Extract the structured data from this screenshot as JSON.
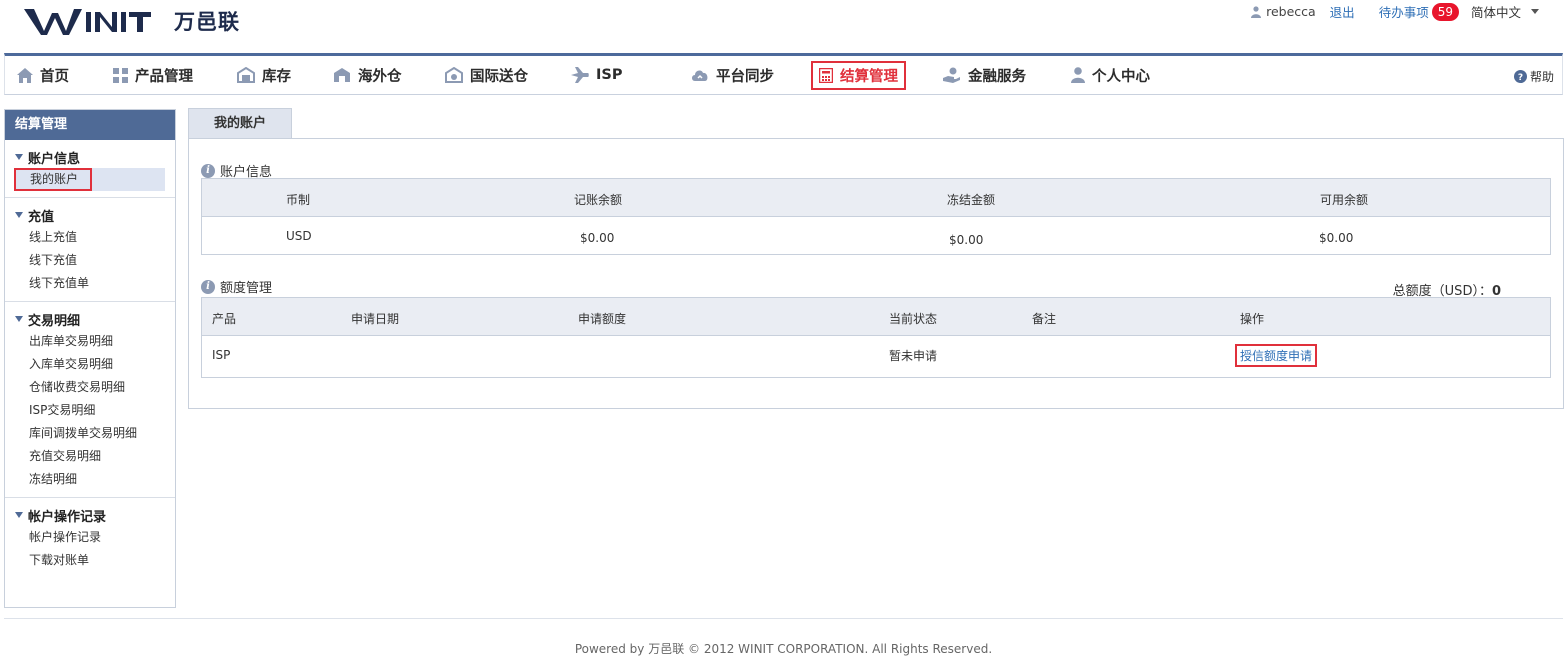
{
  "header": {
    "logo_text": "万邑联",
    "logo_mark": "WINIT",
    "username": "rebecca",
    "logout": "退出",
    "todo_label": "待办事项",
    "todo_count": "59",
    "language": "简体中文"
  },
  "nav": {
    "items": [
      {
        "label": "首页",
        "icon": "home-icon"
      },
      {
        "label": "产品管理",
        "icon": "grid-icon"
      },
      {
        "label": "库存",
        "icon": "inventory-icon"
      },
      {
        "label": "海外仓",
        "icon": "warehouse-icon"
      },
      {
        "label": "国际送仓",
        "icon": "shipping-icon"
      },
      {
        "label": "ISP",
        "icon": "plane-icon"
      },
      {
        "label": "平台同步",
        "icon": "cloud-sync-icon"
      },
      {
        "label": "结算管理",
        "icon": "calculator-icon"
      },
      {
        "label": "金融服务",
        "icon": "finance-icon"
      },
      {
        "label": "个人中心",
        "icon": "person-icon"
      }
    ],
    "active_index": 7,
    "help": "帮助"
  },
  "sidebar": {
    "title": "结算管理",
    "groups": [
      {
        "title": "账户信息",
        "items": [
          "我的账户"
        ]
      },
      {
        "title": "充值",
        "items": [
          "线上充值",
          "线下充值",
          "线下充值单"
        ]
      },
      {
        "title": "交易明细",
        "items": [
          "出库单交易明细",
          "入库单交易明细",
          "仓储收费交易明细",
          "ISP交易明细",
          "库间调拨单交易明细",
          "充值交易明细",
          "冻结明细"
        ]
      },
      {
        "title": "帐户操作记录",
        "items": [
          "帐户操作记录",
          "下载对账单"
        ]
      }
    ],
    "selected": "我的账户"
  },
  "main": {
    "tab": "我的账户",
    "account_section": {
      "title": "账户信息",
      "headers": [
        "币制",
        "记账余额",
        "冻结金额",
        "可用余额"
      ],
      "row": [
        "USD",
        "$0.00",
        "$0.00",
        "$0.00"
      ]
    },
    "credit_section": {
      "title": "额度管理",
      "total_label": "总额度（USD）：",
      "total_value": "0",
      "headers": [
        "产品",
        "申请日期",
        "申请额度",
        "当前状态",
        "备注",
        "操作"
      ],
      "rows": [
        {
          "product": "ISP",
          "date": "",
          "amount": "",
          "status": "暂未申请",
          "note": "",
          "action": "授信额度申请"
        }
      ]
    }
  },
  "footer": {
    "text": "Powered by 万邑联 © 2012 WINIT CORPORATION. All Rights Reserved."
  },
  "colors": {
    "brand_navy": "#1e2b4c",
    "nav_border": "#4d6a9b",
    "highlight_red": "#e0303b",
    "link_blue": "#2f6fb6",
    "badge_red": "#e8152c"
  }
}
